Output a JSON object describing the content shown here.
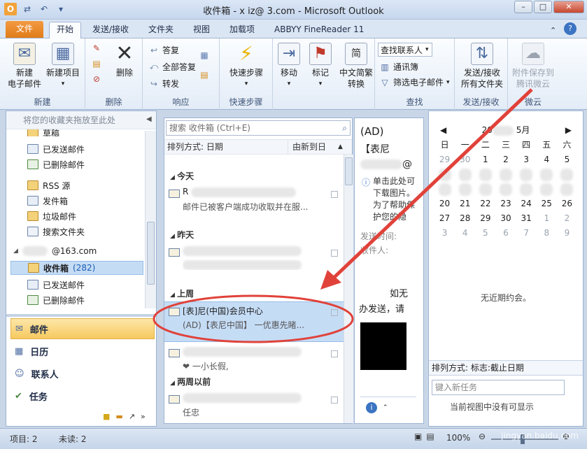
{
  "window": {
    "title": "收件箱 - x        iz@    3.com - Microsoft Outlook"
  },
  "tabs": [
    "文件",
    "开始",
    "发送/接收",
    "文件夹",
    "视图",
    "加载项",
    "ABBYY FineReader 11"
  ],
  "ribbon": {
    "new_group": {
      "label": "新建",
      "new_email": "新建\n电子邮件",
      "new_items": "新建项目"
    },
    "delete_group": {
      "label": "删除",
      "delete": "删除"
    },
    "respond_group": {
      "label": "响应",
      "reply": "答复",
      "reply_all": "全部答复",
      "forward": "转发"
    },
    "quicksteps_group": {
      "label": "快速步骤",
      "quicksteps": "快速步骤"
    },
    "move": "移动",
    "tags": "标记",
    "chinese_conv": "中文简繁\n转换",
    "find_group": {
      "label": "查找",
      "find_contact": "查找联系人",
      "address_book": "通讯簿",
      "filter_email": "筛选电子邮件"
    },
    "sendrecv_group": {
      "label": "发送/接收",
      "send_all": "发送/接收\n所有文件夹"
    },
    "weiyun_group": {
      "label": "微云",
      "save_attach": "附件保存到\n腾讯微云"
    }
  },
  "nav": {
    "favorites_hint": "将您的收藏夹拖放至此处",
    "folders_top": [
      {
        "label": "草稿"
      },
      {
        "label": "已发送邮件"
      },
      {
        "label": "已删除邮件"
      },
      {
        "label": "RSS 源"
      },
      {
        "label": "发件箱"
      },
      {
        "label": "垃圾邮件"
      },
      {
        "label": "搜索文件夹"
      }
    ],
    "account": "@163.com",
    "account_folders": [
      {
        "label": "收件箱",
        "count": "(282)"
      },
      {
        "label": "已发送邮件",
        "count": ""
      },
      {
        "label": "已删除邮件",
        "count": ""
      }
    ],
    "modules": [
      "邮件",
      "日历",
      "联系人",
      "任务"
    ]
  },
  "maillist": {
    "search_placeholder": "搜索 收件箱 (Ctrl+E)",
    "sort_label": "排列方式: 日期",
    "sort_order": "由新到日",
    "groups": [
      {
        "name": "今天",
        "items": [
          {
            "from": "R",
            "preview": "邮件已被客户端成功收取并在服..."
          }
        ]
      },
      {
        "name": "昨天",
        "items": [
          {
            "from": "",
            "preview": ""
          }
        ]
      },
      {
        "name": "上周",
        "items": [
          {
            "from": "[表]尼(中国)会员中心",
            "preview": "(AD)【表尼中国】   一优惠先睹...",
            "selected": true
          },
          {
            "from": "",
            "preview": "  ❤    一小长假,"
          }
        ]
      },
      {
        "name": "两周以前",
        "items": [
          {
            "from": "",
            "preview": "                        任忠"
          }
        ]
      }
    ]
  },
  "reading": {
    "subject_prefix": "(AD)",
    "subject2": "【表尼",
    "email_tail": "@",
    "info": "单击此处可下载图片。为了帮助保护您的隐",
    "sent_label": "发送时间:",
    "to_label": "收件人:",
    "body1": "如无",
    "body2": "办发送，请"
  },
  "todo": {
    "month": "5月",
    "year_prefix": "20",
    "weekdays": [
      "日",
      "一",
      "二",
      "三",
      "四",
      "五",
      "六"
    ],
    "row1": [
      "29",
      "30",
      "1",
      "2",
      "3",
      "4",
      "5"
    ],
    "row_a": [
      "20",
      "21",
      "22",
      "23",
      "24",
      "25",
      "26"
    ],
    "row_b": [
      "27",
      "28",
      "29",
      "30",
      "31",
      "1",
      "2"
    ],
    "row_c": [
      "3",
      "4",
      "5",
      "6",
      "7",
      "8",
      "9"
    ],
    "no_appointments": "无近期约会。",
    "sort_label": "排列方式: 标志:截止日期",
    "new_task_placeholder": "键入新任务",
    "task_hint": "当前视图中没有可显示"
  },
  "status": {
    "items": "项目: 2",
    "unread": "未读: 2",
    "zoom": "100%"
  },
  "colors": {
    "accent": "#e07c18",
    "arrow": "#e0423a",
    "selection": "#c5dcf5"
  },
  "watermark": "jingyan.baidu.com"
}
